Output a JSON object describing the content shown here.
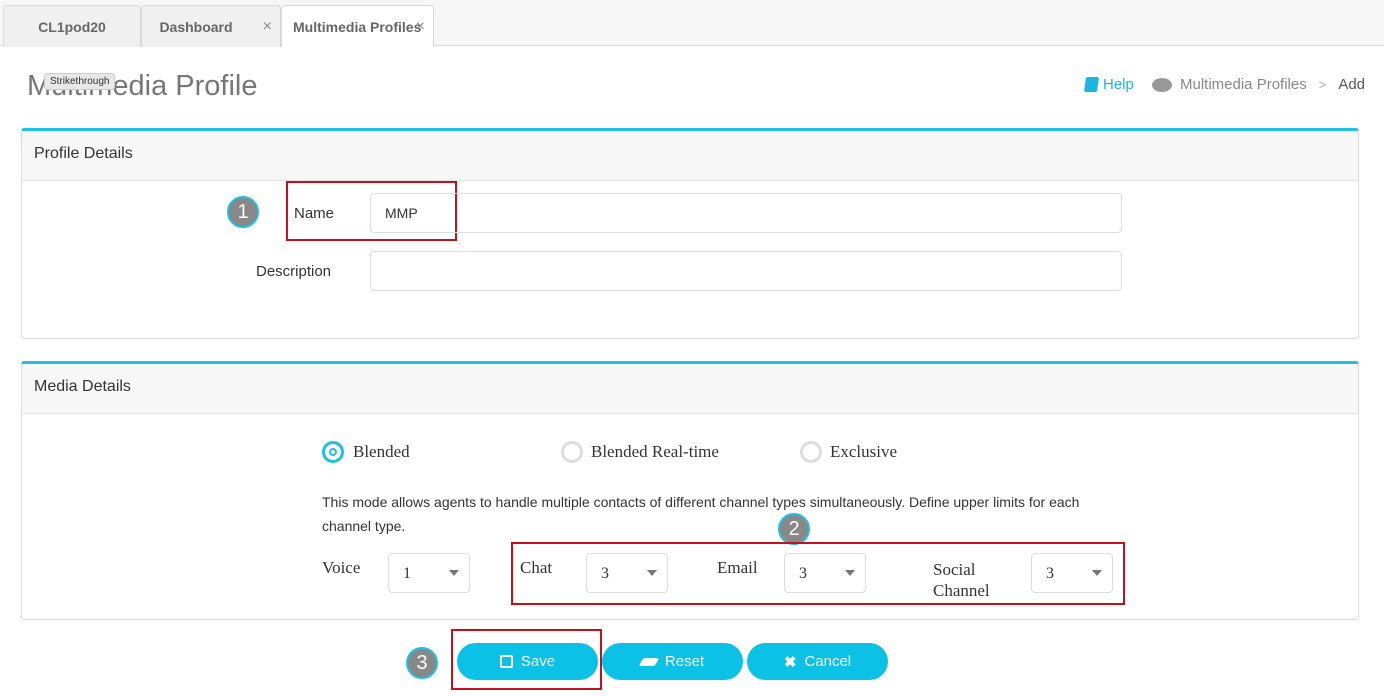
{
  "tabs": [
    {
      "label": "CL1pod20"
    },
    {
      "label": "Dashboard",
      "closable": true
    },
    {
      "label": "Multimedia Profiles",
      "closable": true,
      "active": true
    }
  ],
  "tab_close": "×",
  "page_title": "Multimedia Profile",
  "tooltip": "Strikethrough",
  "breadcrumb": {
    "help": "Help",
    "section": "Multimedia Profiles",
    "sep": ">",
    "current": "Add"
  },
  "profile_details": {
    "header": "Profile Details",
    "name_label": "Name",
    "name_value": "MMP",
    "description_label": "Description",
    "description_value": ""
  },
  "media_details": {
    "header": "Media Details",
    "modes": [
      {
        "label": "Blended",
        "selected": true
      },
      {
        "label": "Blended Real-time",
        "selected": false
      },
      {
        "label": "Exclusive",
        "selected": false
      }
    ],
    "description": "This mode allows agents to handle multiple contacts of different channel types simultaneously. Define upper limits for each channel type.",
    "channels": [
      {
        "label": "Voice",
        "value": "1"
      },
      {
        "label": "Chat",
        "value": "3"
      },
      {
        "label": "Email",
        "value": "3"
      },
      {
        "label": "Social Channel",
        "value": "3"
      }
    ]
  },
  "buttons": {
    "save": "Save",
    "reset": "Reset",
    "cancel": "Cancel"
  },
  "callouts": [
    "1",
    "2",
    "3"
  ],
  "colors": {
    "accent": "#0bc2e6",
    "callout_box": "#c0121c"
  }
}
